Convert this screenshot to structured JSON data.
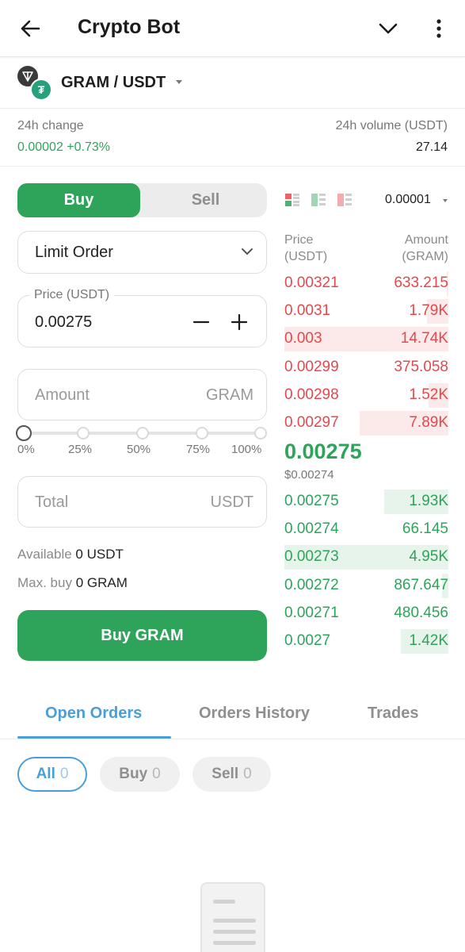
{
  "header": {
    "title": "Crypto Bot"
  },
  "pair": {
    "name": "GRAM / USDT",
    "coin2_symbol": "₮"
  },
  "stats": {
    "change_label": "24h change",
    "change_value": "0.00002 +0.73%",
    "volume_label": "24h volume (USDT)",
    "volume_value": "27.14"
  },
  "trade": {
    "buy_label": "Buy",
    "sell_label": "Sell",
    "order_type": "Limit Order",
    "price_label": "Price (USDT)",
    "price_value": "0.00275",
    "amount_placeholder": "Amount",
    "amount_unit": "GRAM",
    "slider_percents": [
      "0%",
      "25%",
      "50%",
      "75%",
      "100%"
    ],
    "slider_value": 0,
    "total_placeholder": "Total",
    "total_unit": "USDT",
    "available_label": "Available",
    "available_value": "0 USDT",
    "maxbuy_label": "Max. buy",
    "maxbuy_value": "0 GRAM",
    "submit_label": "Buy GRAM"
  },
  "orderbook": {
    "precision": "0.00001",
    "price_header_1": "Price",
    "price_header_2": "(USDT)",
    "amount_header_1": "Amount",
    "amount_header_2": "(GRAM)",
    "asks": [
      {
        "price": "0.00321",
        "amount": "633.215",
        "depth": 0.01
      },
      {
        "price": "0.0031",
        "amount": "1.79K",
        "depth": 0.13
      },
      {
        "price": "0.003",
        "amount": "14.74K",
        "depth": 1.0
      },
      {
        "price": "0.00299",
        "amount": "375.058",
        "depth": 0.0
      },
      {
        "price": "0.00298",
        "amount": "1.52K",
        "depth": 0.12
      },
      {
        "price": "0.00297",
        "amount": "7.89K",
        "depth": 0.54
      }
    ],
    "last_price": "0.00275",
    "last_price_usd": "$0.00274",
    "bids": [
      {
        "price": "0.00275",
        "amount": "1.93K",
        "depth": 0.39
      },
      {
        "price": "0.00274",
        "amount": "66.145",
        "depth": 0.0
      },
      {
        "price": "0.00273",
        "amount": "4.95K",
        "depth": 1.0
      },
      {
        "price": "0.00272",
        "amount": "867.647",
        "depth": 0.04
      },
      {
        "price": "0.00271",
        "amount": "480.456",
        "depth": 0.0
      },
      {
        "price": "0.0027",
        "amount": "1.42K",
        "depth": 0.29
      }
    ]
  },
  "tabs": [
    "Open Orders",
    "Orders History",
    "Trades"
  ],
  "filters": [
    {
      "label": "All",
      "count": "0"
    },
    {
      "label": "Buy",
      "count": "0"
    },
    {
      "label": "Sell",
      "count": "0"
    }
  ],
  "colors": {
    "green": "#2ea45a",
    "red": "#e5484d",
    "accent": "#4a9fd8"
  }
}
